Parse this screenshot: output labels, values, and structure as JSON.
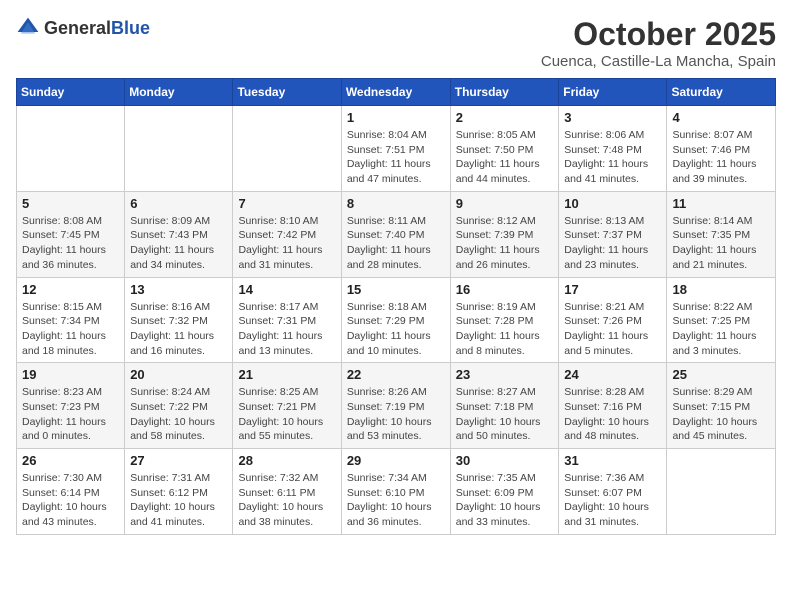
{
  "header": {
    "logo_general": "General",
    "logo_blue": "Blue",
    "month_title": "October 2025",
    "subtitle": "Cuenca, Castille-La Mancha, Spain"
  },
  "weekdays": [
    "Sunday",
    "Monday",
    "Tuesday",
    "Wednesday",
    "Thursday",
    "Friday",
    "Saturday"
  ],
  "weeks": [
    [
      {
        "day": "",
        "info": ""
      },
      {
        "day": "",
        "info": ""
      },
      {
        "day": "",
        "info": ""
      },
      {
        "day": "1",
        "info": "Sunrise: 8:04 AM\nSunset: 7:51 PM\nDaylight: 11 hours and 47 minutes."
      },
      {
        "day": "2",
        "info": "Sunrise: 8:05 AM\nSunset: 7:50 PM\nDaylight: 11 hours and 44 minutes."
      },
      {
        "day": "3",
        "info": "Sunrise: 8:06 AM\nSunset: 7:48 PM\nDaylight: 11 hours and 41 minutes."
      },
      {
        "day": "4",
        "info": "Sunrise: 8:07 AM\nSunset: 7:46 PM\nDaylight: 11 hours and 39 minutes."
      }
    ],
    [
      {
        "day": "5",
        "info": "Sunrise: 8:08 AM\nSunset: 7:45 PM\nDaylight: 11 hours and 36 minutes."
      },
      {
        "day": "6",
        "info": "Sunrise: 8:09 AM\nSunset: 7:43 PM\nDaylight: 11 hours and 34 minutes."
      },
      {
        "day": "7",
        "info": "Sunrise: 8:10 AM\nSunset: 7:42 PM\nDaylight: 11 hours and 31 minutes."
      },
      {
        "day": "8",
        "info": "Sunrise: 8:11 AM\nSunset: 7:40 PM\nDaylight: 11 hours and 28 minutes."
      },
      {
        "day": "9",
        "info": "Sunrise: 8:12 AM\nSunset: 7:39 PM\nDaylight: 11 hours and 26 minutes."
      },
      {
        "day": "10",
        "info": "Sunrise: 8:13 AM\nSunset: 7:37 PM\nDaylight: 11 hours and 23 minutes."
      },
      {
        "day": "11",
        "info": "Sunrise: 8:14 AM\nSunset: 7:35 PM\nDaylight: 11 hours and 21 minutes."
      }
    ],
    [
      {
        "day": "12",
        "info": "Sunrise: 8:15 AM\nSunset: 7:34 PM\nDaylight: 11 hours and 18 minutes."
      },
      {
        "day": "13",
        "info": "Sunrise: 8:16 AM\nSunset: 7:32 PM\nDaylight: 11 hours and 16 minutes."
      },
      {
        "day": "14",
        "info": "Sunrise: 8:17 AM\nSunset: 7:31 PM\nDaylight: 11 hours and 13 minutes."
      },
      {
        "day": "15",
        "info": "Sunrise: 8:18 AM\nSunset: 7:29 PM\nDaylight: 11 hours and 10 minutes."
      },
      {
        "day": "16",
        "info": "Sunrise: 8:19 AM\nSunset: 7:28 PM\nDaylight: 11 hours and 8 minutes."
      },
      {
        "day": "17",
        "info": "Sunrise: 8:21 AM\nSunset: 7:26 PM\nDaylight: 11 hours and 5 minutes."
      },
      {
        "day": "18",
        "info": "Sunrise: 8:22 AM\nSunset: 7:25 PM\nDaylight: 11 hours and 3 minutes."
      }
    ],
    [
      {
        "day": "19",
        "info": "Sunrise: 8:23 AM\nSunset: 7:23 PM\nDaylight: 11 hours and 0 minutes."
      },
      {
        "day": "20",
        "info": "Sunrise: 8:24 AM\nSunset: 7:22 PM\nDaylight: 10 hours and 58 minutes."
      },
      {
        "day": "21",
        "info": "Sunrise: 8:25 AM\nSunset: 7:21 PM\nDaylight: 10 hours and 55 minutes."
      },
      {
        "day": "22",
        "info": "Sunrise: 8:26 AM\nSunset: 7:19 PM\nDaylight: 10 hours and 53 minutes."
      },
      {
        "day": "23",
        "info": "Sunrise: 8:27 AM\nSunset: 7:18 PM\nDaylight: 10 hours and 50 minutes."
      },
      {
        "day": "24",
        "info": "Sunrise: 8:28 AM\nSunset: 7:16 PM\nDaylight: 10 hours and 48 minutes."
      },
      {
        "day": "25",
        "info": "Sunrise: 8:29 AM\nSunset: 7:15 PM\nDaylight: 10 hours and 45 minutes."
      }
    ],
    [
      {
        "day": "26",
        "info": "Sunrise: 7:30 AM\nSunset: 6:14 PM\nDaylight: 10 hours and 43 minutes."
      },
      {
        "day": "27",
        "info": "Sunrise: 7:31 AM\nSunset: 6:12 PM\nDaylight: 10 hours and 41 minutes."
      },
      {
        "day": "28",
        "info": "Sunrise: 7:32 AM\nSunset: 6:11 PM\nDaylight: 10 hours and 38 minutes."
      },
      {
        "day": "29",
        "info": "Sunrise: 7:34 AM\nSunset: 6:10 PM\nDaylight: 10 hours and 36 minutes."
      },
      {
        "day": "30",
        "info": "Sunrise: 7:35 AM\nSunset: 6:09 PM\nDaylight: 10 hours and 33 minutes."
      },
      {
        "day": "31",
        "info": "Sunrise: 7:36 AM\nSunset: 6:07 PM\nDaylight: 10 hours and 31 minutes."
      },
      {
        "day": "",
        "info": ""
      }
    ]
  ]
}
